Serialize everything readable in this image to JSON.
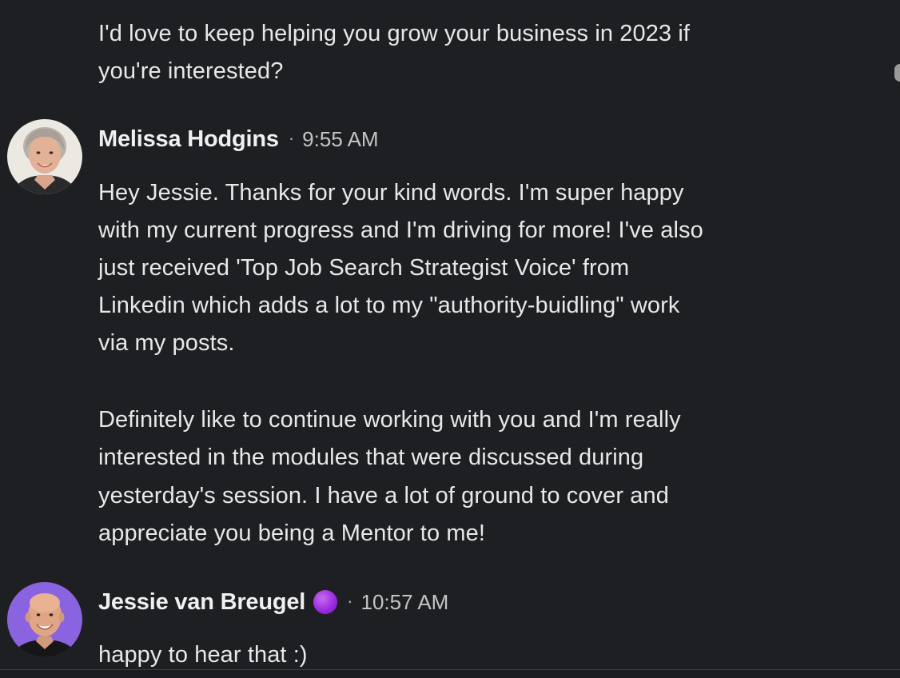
{
  "messages": [
    {
      "sender": null,
      "lines": [
        "I'd love to keep helping you grow your business in 2023 if",
        "you're interested?"
      ]
    },
    {
      "sender": "Melissa Hodgins",
      "time": "9:55 AM",
      "separator": "·",
      "avatar_icon": "profile-photo-icon",
      "lines": [
        "Hey Jessie. Thanks for your kind words.  I'm super happy",
        "with my current progress and I'm driving for more! I've also",
        "just received 'Top Job Search Strategist Voice' from",
        "Linkedin which adds a lot to my \"authority-buidling\" work",
        "via my posts.",
        "",
        "Definitely like to continue working with you and I'm really",
        "interested in the modules that were discussed during",
        "yesterday's session.  I have a lot of ground to cover and",
        "appreciate you being a Mentor to me!"
      ]
    },
    {
      "sender": "Jessie van Breugel",
      "time": "10:57 AM",
      "separator": "·",
      "avatar_icon": "profile-photo-icon",
      "badge_icon": "premium-badge-icon",
      "badge_color": "#a02ee0",
      "lines": [
        "happy to hear that :)"
      ]
    }
  ],
  "colors": {
    "background": "#1d1f22",
    "text": "#e8e8e8",
    "timestamp": "#c4c4c4",
    "avatar_jessie_bg": "#8a63e0"
  }
}
